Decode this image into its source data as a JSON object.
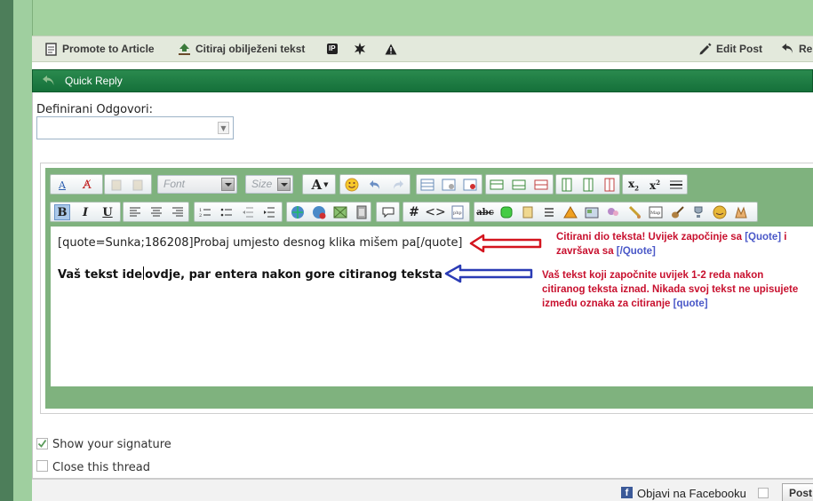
{
  "post_toolbar": {
    "promote_label": "Promote to Article",
    "quote_selected_label": "Citiraj obilježeni tekst",
    "ip_badge": "IP",
    "edit_label": "Edit Post",
    "reply_label": "Re"
  },
  "quick_reply": {
    "title": "Quick Reply"
  },
  "predefined": {
    "label": "Definirani Odgovori:",
    "value": ""
  },
  "editor": {
    "font_placeholder": "Font",
    "size_placeholder": "Size",
    "quote_text": "[quote=Sunka;186208]Probaj umjesto desnog klika mišem pa[/quote]",
    "body_before_caret": "Vaš tekst ide",
    "body_after_caret": "ovdje, par entera nakon gore citiranog teksta"
  },
  "annotations": {
    "red_text": "Citirani dio teksta! Uvijek započinje sa",
    "red_tag1": "[Quote]",
    "red_mid": "i završava sa",
    "red_tag2": "[/Quote]",
    "blue_text": "Vaš tekst koji započnite uvijek 1-2 reda nakon citiranog teksta iznad. Nikada svoj tekst ne upisujete između oznaka za citiranje",
    "blue_tag": "[quote]",
    "red_arrow_color": "#d4141e",
    "blue_arrow_color": "#2a3bb5"
  },
  "options": {
    "show_signature": {
      "label": "Show your signature",
      "checked": true
    },
    "close_thread": {
      "label": "Close this thread",
      "checked": false
    }
  },
  "footer": {
    "facebook_label": "Objavi na Facebooku",
    "post_button": "Post"
  }
}
